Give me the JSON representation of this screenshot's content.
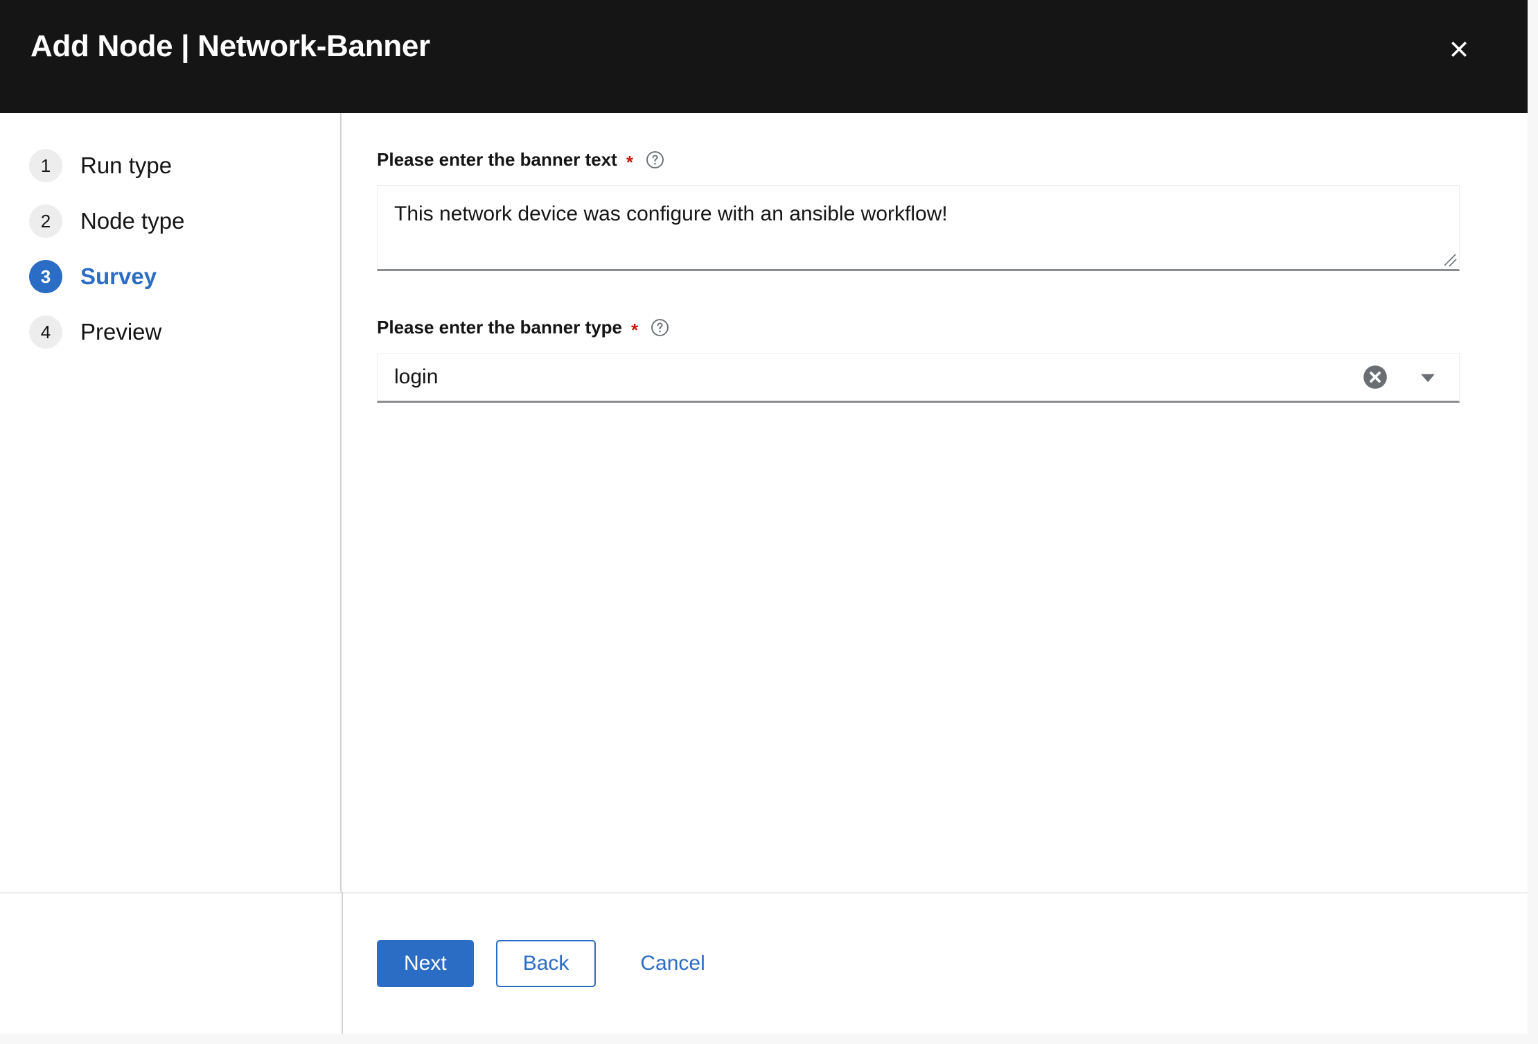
{
  "header": {
    "title": "Add Node | Network-Banner",
    "close_icon": "close-icon"
  },
  "sidebar": {
    "items": [
      {
        "number": "1",
        "label": "Run type",
        "active": false
      },
      {
        "number": "2",
        "label": "Node type",
        "active": false
      },
      {
        "number": "3",
        "label": "Survey",
        "active": true
      },
      {
        "number": "4",
        "label": "Preview",
        "active": false
      }
    ]
  },
  "form": {
    "banner_text": {
      "label": "Please enter the banner text",
      "required_mark": "*",
      "help_icon": "help-circle-icon",
      "value": "This network device was configure with an ansible workflow!",
      "placeholder": ""
    },
    "banner_type": {
      "label": "Please enter the banner type",
      "required_mark": "*",
      "help_icon": "help-circle-icon",
      "value": "login",
      "clear_icon": "clear-circle-icon",
      "caret_icon": "chevron-down-icon"
    }
  },
  "footer": {
    "next_label": "Next",
    "back_label": "Back",
    "cancel_label": "Cancel"
  },
  "colors": {
    "header_bg": "#151515",
    "accent": "#2b6cc4",
    "required": "#c9190b",
    "badge_bg": "#ededed",
    "divider": "#d2d2d2",
    "input_underline": "#8a8d90"
  }
}
